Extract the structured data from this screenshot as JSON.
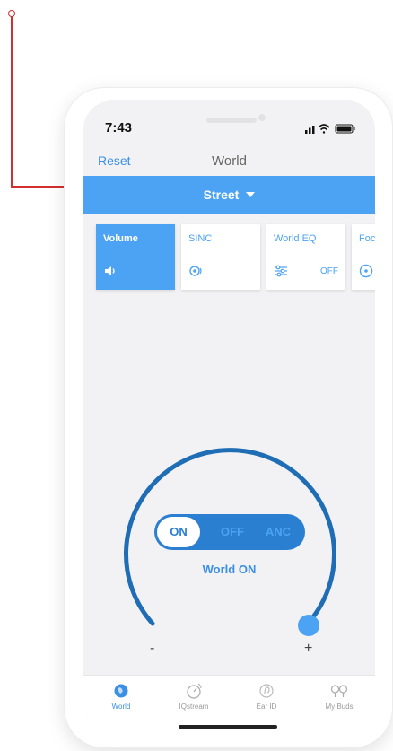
{
  "status_bar": {
    "time": "7:43"
  },
  "nav": {
    "reset_label": "Reset",
    "title": "World"
  },
  "mode": {
    "selected": "Street"
  },
  "cards": [
    {
      "label": "Volume",
      "icon": "speaker-icon",
      "status": "",
      "active": true
    },
    {
      "label": "SINC",
      "icon": "sinc-icon",
      "status": "",
      "active": false
    },
    {
      "label": "World EQ",
      "icon": "equalizer-icon",
      "status": "OFF",
      "active": false
    },
    {
      "label": "Foc",
      "icon": "focus-icon",
      "status": "",
      "active": false
    }
  ],
  "dial": {
    "minus_label": "-",
    "plus_label": "+",
    "level": 1.0
  },
  "toggle": {
    "on_label": "ON",
    "off_label": "OFF",
    "anc_label": "ANC",
    "selected": "ON"
  },
  "world_state": "World ON",
  "tabs": [
    {
      "label": "World",
      "icon": "globe-icon",
      "active": true
    },
    {
      "label": "IQstream",
      "icon": "stream-icon",
      "active": false
    },
    {
      "label": "Ear ID",
      "icon": "ear-icon",
      "active": false
    },
    {
      "label": "My Buds",
      "icon": "earbuds-icon",
      "active": false
    }
  ],
  "colors": {
    "accent": "#4da3f3",
    "dial": "#1f6db5",
    "annotation": "#d32f2f"
  }
}
